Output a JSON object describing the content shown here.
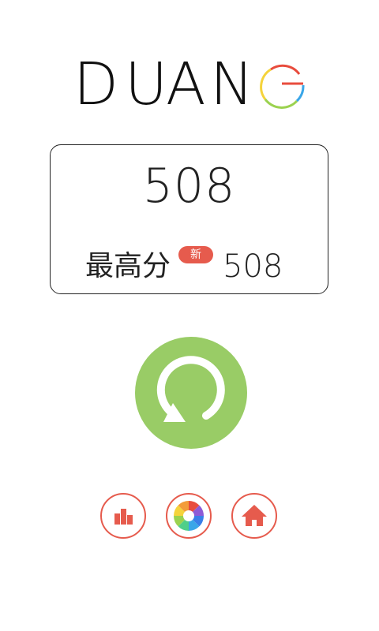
{
  "logo": {
    "text": "DUANG",
    "letters": [
      "D",
      "U",
      "A",
      "N"
    ],
    "ring_colors": [
      "#e84c3d",
      "#f5d33b",
      "#9bd24f",
      "#3aa6e8"
    ],
    "text_color": "#111111"
  },
  "score": {
    "current": "508",
    "best_label": "最高分",
    "new_badge": "新",
    "best": "508"
  },
  "actions": {
    "replay": {
      "icon": "replay-icon",
      "color": "#99cc66"
    },
    "rank": {
      "icon": "bar-chart-icon"
    },
    "share": {
      "icon": "aperture-icon"
    },
    "home": {
      "icon": "home-icon"
    },
    "accent_color": "#e65b4d"
  }
}
